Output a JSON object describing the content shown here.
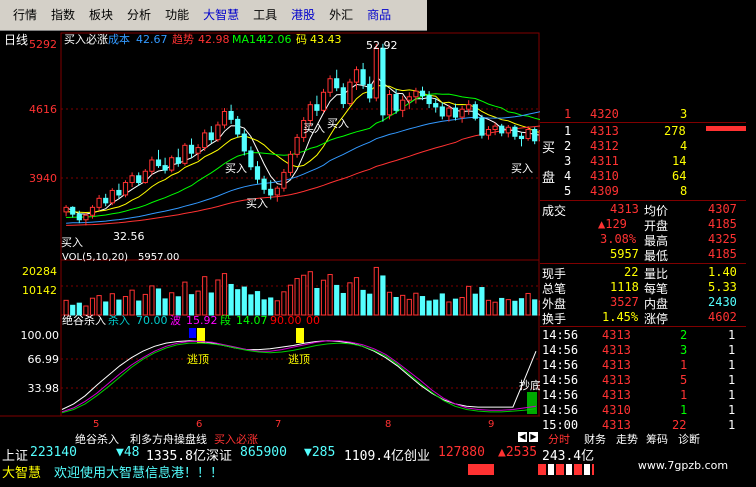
{
  "menu": [
    "行情",
    "指数",
    "板块",
    "分析",
    "功能",
    "大智慧",
    "工具",
    "港股",
    "外汇",
    "商品"
  ],
  "main_chart": {
    "period_label": "日线",
    "indicator_label": "买入必涨",
    "cost_label": "成本",
    "cost_value": "42.67",
    "hidden_label": "趋势",
    "hidden_value": "42.98",
    "ma14_label": "MA14",
    "ma14_value": "42.06",
    "code_label": "码",
    "code_value": "43.43",
    "y_ticks": [
      "5292",
      "4616",
      "3940"
    ],
    "high_label": "52.92",
    "low_label": "32.56",
    "signal_labels": [
      "买入",
      "买入",
      "买入",
      "买入",
      "买入",
      "买入"
    ]
  },
  "volume_chart": {
    "label": "VOL(5,10,20)",
    "value": "5957.00",
    "y_ticks": [
      "20284",
      "10142"
    ]
  },
  "osc_chart": {
    "name": "绝谷杀入",
    "items": [
      {
        "label": "杀入",
        "value": "70.00",
        "color": "#00cccc"
      },
      {
        "label": "波",
        "value": "15.92",
        "color": "#ff00ff"
      },
      {
        "label": "段",
        "value": "14.07",
        "color": "#00ff00"
      }
    ],
    "extra_values": [
      "90.00",
      "00"
    ],
    "y_ticks": [
      "100.00",
      "66.99",
      "33.98"
    ],
    "signal_labels": [
      "逃顶",
      "逃顶",
      "抄底"
    ]
  },
  "x_ticks": [
    "5",
    "6",
    "7",
    "8",
    "9"
  ],
  "bottom_tabs": [
    "绝谷杀入",
    "利多方舟操盘线",
    "买入必涨"
  ],
  "order_book": {
    "sell_label": "卖",
    "buy_label": "买",
    "buy_label2": "盘",
    "rows": [
      {
        "level": "1",
        "price": "4320",
        "vol": "3",
        "side": "sell"
      },
      {
        "level": "1",
        "price": "4313",
        "vol": "278",
        "side": "buy"
      },
      {
        "level": "2",
        "price": "4312",
        "vol": "4",
        "side": "buy"
      },
      {
        "level": "3",
        "price": "4311",
        "vol": "14",
        "side": "buy"
      },
      {
        "level": "4",
        "price": "4310",
        "vol": "64",
        "side": "buy"
      },
      {
        "level": "5",
        "price": "4309",
        "vol": "8",
        "side": "buy"
      }
    ]
  },
  "quote": [
    {
      "l1": "成交",
      "v1": "4313",
      "l2": "均价",
      "v2": "4307"
    },
    {
      "l1": "",
      "v1": "▲129",
      "l2": "开盘",
      "v2": "4185"
    },
    {
      "l1": "",
      "v1": "3.08%",
      "l2": "最高",
      "v2": "4325"
    },
    {
      "l1": "",
      "v1": "5957",
      "l2": "最低",
      "v2": "4185"
    },
    {
      "l1": "现手",
      "v1": "22",
      "l2": "量比",
      "v2": "1.40"
    },
    {
      "l1": "总笔",
      "v1": "1118",
      "l2": "每笔",
      "v2": "5.33"
    },
    {
      "l1": "外盘",
      "v1": "3527",
      "l2": "内盘",
      "v2": "2430"
    },
    {
      "l1": "换手",
      "v1": "1.45%",
      "l2": "涨停",
      "v2": "4602"
    }
  ],
  "ticks": [
    {
      "time": "14:56",
      "price": "4313",
      "vol": "2",
      "flag": "1"
    },
    {
      "time": "14:56",
      "price": "4313",
      "vol": "3",
      "flag": "1"
    },
    {
      "time": "14:56",
      "price": "4313",
      "vol": "1",
      "flag": "1"
    },
    {
      "time": "14:56",
      "price": "4313",
      "vol": "5",
      "flag": "1"
    },
    {
      "time": "14:56",
      "price": "4313",
      "vol": "1",
      "flag": "1"
    },
    {
      "time": "14:56",
      "price": "4310",
      "vol": "1",
      "flag": "1"
    },
    {
      "time": "15:00",
      "price": "4313",
      "vol": "22",
      "flag": "1"
    }
  ],
  "right_tabs": [
    "分时",
    "财务",
    "走势",
    "筹码",
    "诊断"
  ],
  "status1": {
    "sh_label": "上证",
    "sh_value": "223140",
    "sh_chg": "▼48",
    "sh_amt": "1335.8亿",
    "sz_label": "深证",
    "sz_value": "865900",
    "sz_chg": "▼285",
    "sz_amt": "1109.4亿",
    "cy_label": "创业",
    "cy_value": "127880",
    "cy_chg": "▲2535",
    "cy_amt": "243.4亿"
  },
  "status2": {
    "brand": "大智慧",
    "message": "欢迎使用大智慧信息港！！！"
  },
  "watermark": "www.7gpzb.com",
  "colors": {
    "up": "#ff3232",
    "down": "#54ffff",
    "ma5": "#ffffff",
    "ma10": "#ffff00",
    "ma20": "#ff00ff",
    "ma60": "#00ff00",
    "ma120": "#3399ff",
    "ma250": "#ff3232",
    "grid": "#800000"
  },
  "candles": [
    [
      38.0,
      38.6,
      37.6,
      38.4
    ],
    [
      38.4,
      38.5,
      37.5,
      37.8
    ],
    [
      37.8,
      38.1,
      37.0,
      37.3
    ],
    [
      37.3,
      37.9,
      36.8,
      37.7
    ],
    [
      37.7,
      38.6,
      37.4,
      38.4
    ],
    [
      38.4,
      39.5,
      38.1,
      39.2
    ],
    [
      39.2,
      39.6,
      38.5,
      38.8
    ],
    [
      38.8,
      40.1,
      38.6,
      39.9
    ],
    [
      39.9,
      40.5,
      39.2,
      39.5
    ],
    [
      39.5,
      40.8,
      39.3,
      40.6
    ],
    [
      40.6,
      41.5,
      40.2,
      41.2
    ],
    [
      41.2,
      41.5,
      40.3,
      40.6
    ],
    [
      40.6,
      41.8,
      40.5,
      41.6
    ],
    [
      41.6,
      42.9,
      41.3,
      42.6
    ],
    [
      42.6,
      43.5,
      41.9,
      42.1
    ],
    [
      42.1,
      42.8,
      41.4,
      41.7
    ],
    [
      41.7,
      43.0,
      41.5,
      42.8
    ],
    [
      42.8,
      43.6,
      42.0,
      42.3
    ],
    [
      42.3,
      44.1,
      42.1,
      43.9
    ],
    [
      43.9,
      44.5,
      42.8,
      43.2
    ],
    [
      43.2,
      44.0,
      42.6,
      43.7
    ],
    [
      43.7,
      45.3,
      43.4,
      45.0
    ],
    [
      45.0,
      45.6,
      44.1,
      44.4
    ],
    [
      44.4,
      46.0,
      44.2,
      45.7
    ],
    [
      45.7,
      47.2,
      45.4,
      46.9
    ],
    [
      46.9,
      47.5,
      45.8,
      46.2
    ],
    [
      46.2,
      46.5,
      44.6,
      44.9
    ],
    [
      44.9,
      45.3,
      43.0,
      43.4
    ],
    [
      43.4,
      43.8,
      41.7,
      42.0
    ],
    [
      42.0,
      42.5,
      40.5,
      40.9
    ],
    [
      40.9,
      41.2,
      39.6,
      40.0
    ],
    [
      40.0,
      40.8,
      39.1,
      39.5
    ],
    [
      39.5,
      40.3,
      38.9,
      40.1
    ],
    [
      40.1,
      41.8,
      39.8,
      41.5
    ],
    [
      41.5,
      43.4,
      41.2,
      43.1
    ],
    [
      43.1,
      44.9,
      42.8,
      44.6
    ],
    [
      44.6,
      46.4,
      44.2,
      46.1
    ],
    [
      46.1,
      47.8,
      45.6,
      47.5
    ],
    [
      47.5,
      48.3,
      46.5,
      47.0
    ],
    [
      47.0,
      48.9,
      46.8,
      48.6
    ],
    [
      48.6,
      50.1,
      48.2,
      49.8
    ],
    [
      49.8,
      50.6,
      48.7,
      49.0
    ],
    [
      49.0,
      49.4,
      47.2,
      47.6
    ],
    [
      47.6,
      49.8,
      47.4,
      49.5
    ],
    [
      49.5,
      50.9,
      48.8,
      50.6
    ],
    [
      50.6,
      51.2,
      48.9,
      49.3
    ],
    [
      49.3,
      50.0,
      47.7,
      48.1
    ],
    [
      48.1,
      52.9,
      47.8,
      52.5
    ],
    [
      52.5,
      52.9,
      46.0,
      46.6
    ],
    [
      46.6,
      48.8,
      46.2,
      48.4
    ],
    [
      48.4,
      48.9,
      46.7,
      47.0
    ],
    [
      47.0,
      48.3,
      46.4,
      47.9
    ],
    [
      47.9,
      48.6,
      47.1,
      48.2
    ],
    [
      48.2,
      49.0,
      47.6,
      48.7
    ],
    [
      48.7,
      49.1,
      47.9,
      48.3
    ],
    [
      48.3,
      48.7,
      47.2,
      47.6
    ],
    [
      47.6,
      48.1,
      46.8,
      47.3
    ],
    [
      47.3,
      47.7,
      46.2,
      46.5
    ],
    [
      46.5,
      47.5,
      46.0,
      47.2
    ],
    [
      47.2,
      47.6,
      46.1,
      46.4
    ],
    [
      46.4,
      47.4,
      45.9,
      47.1
    ],
    [
      47.1,
      47.9,
      46.6,
      47.5
    ],
    [
      47.5,
      47.8,
      46.1,
      46.3
    ],
    [
      46.3,
      46.6,
      44.5,
      44.8
    ],
    [
      44.8,
      45.6,
      44.4,
      45.3
    ],
    [
      45.3,
      45.9,
      44.8,
      45.6
    ],
    [
      45.6,
      45.8,
      44.7,
      45.0
    ],
    [
      45.0,
      45.7,
      44.6,
      45.5
    ],
    [
      45.5,
      45.7,
      44.4,
      44.7
    ],
    [
      44.7,
      45.0,
      43.8,
      44.5
    ],
    [
      44.5,
      45.6,
      44.3,
      45.3
    ],
    [
      45.3,
      45.5,
      44.0,
      44.3
    ],
    [
      44.3,
      45.5,
      44.2,
      45.2
    ]
  ],
  "volumes": [
    6.2,
    4.1,
    5.0,
    3.8,
    7.1,
    8.2,
    5.5,
    9.0,
    6.3,
    7.8,
    10.5,
    5.9,
    8.7,
    12.3,
    11.0,
    6.8,
    9.4,
    7.7,
    13.9,
    8.6,
    10.1,
    16.2,
    9.3,
    14.8,
    17.5,
    12.9,
    10.7,
    11.8,
    8.5,
    9.9,
    6.4,
    7.2,
    6.0,
    9.8,
    12.6,
    15.4,
    16.8,
    18.3,
    11.2,
    14.7,
    17.1,
    12.5,
    9.1,
    13.6,
    15.8,
    10.4,
    8.8,
    20.1,
    16.5,
    9.6,
    7.4,
    8.3,
    6.6,
    9.2,
    7.8,
    5.9,
    6.3,
    8.9,
    5.5,
    6.7,
    7.4,
    12.1,
    8.8,
    11.6,
    6.2,
    5.4,
    7.0,
    6.5,
    5.8,
    6.9,
    9.1,
    6.4,
    5.9
  ],
  "osc": {
    "white": [
      8,
      15,
      25,
      38,
      50,
      62,
      72,
      80,
      86,
      90,
      92,
      93,
      92,
      90,
      87,
      84,
      82,
      82,
      83,
      85,
      87,
      90,
      92,
      93,
      92,
      90,
      86,
      80,
      72,
      62,
      50,
      38,
      28,
      20,
      15,
      12,
      11,
      11,
      11,
      11,
      45,
      80
    ],
    "purple": [
      5,
      10,
      18,
      28,
      40,
      52,
      63,
      72,
      80,
      86,
      90,
      92,
      92,
      91,
      88,
      85,
      82,
      80,
      80,
      82,
      85,
      88,
      91,
      93,
      93,
      91,
      88,
      83,
      76,
      66,
      55,
      44,
      32,
      22,
      15,
      10,
      8,
      7,
      7,
      8,
      10,
      12
    ],
    "green": [
      4,
      8,
      15,
      25,
      36,
      48,
      60,
      70,
      78,
      84,
      88,
      90,
      90,
      89,
      87,
      84,
      81,
      79,
      78,
      79,
      81,
      84,
      87,
      89,
      90,
      89,
      86,
      81,
      74,
      64,
      52,
      40,
      29,
      19,
      12,
      8,
      6,
      5,
      5,
      6,
      7,
      9
    ]
  }
}
